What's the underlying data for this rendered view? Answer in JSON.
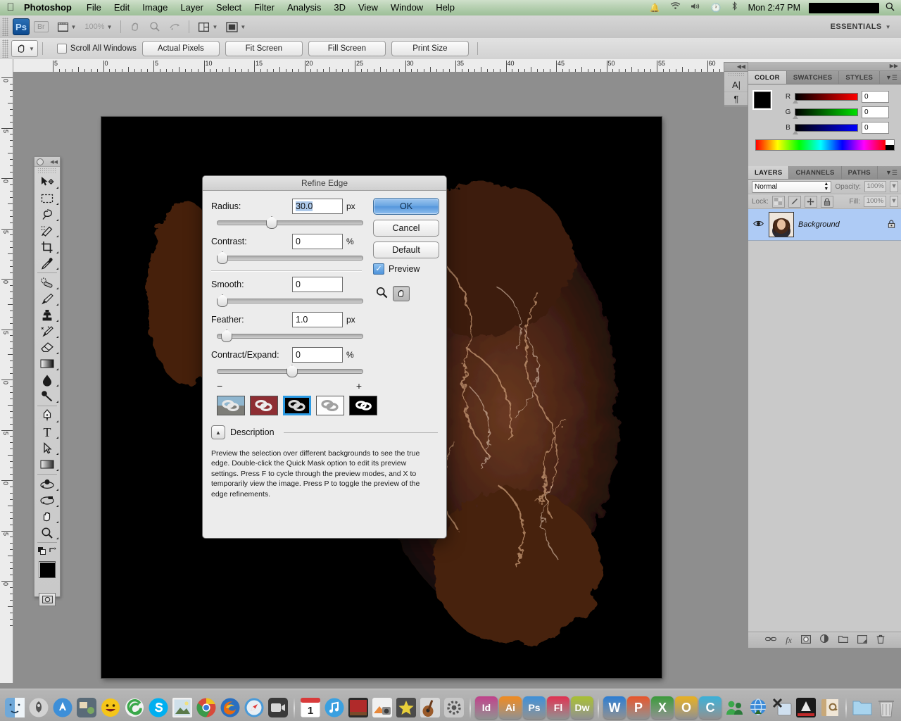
{
  "menubar": {
    "apple_icon": "apple-icon",
    "app_name": "Photoshop",
    "menus": [
      "File",
      "Edit",
      "Image",
      "Layer",
      "Select",
      "Filter",
      "Analysis",
      "3D",
      "View",
      "Window",
      "Help"
    ],
    "status_icons": [
      "notification-bell-icon",
      "wifi-icon",
      "volume-icon",
      "time-machine-icon",
      "bluetooth-icon"
    ],
    "clock": "Mon 2:47 PM",
    "redacted_label": "",
    "search_icon": "spotlight-search-icon"
  },
  "appbar": {
    "logo": "Ps",
    "bridge_label": "Br",
    "mini_bridge_icon": "mini-bridge-icon",
    "zoom_level": "100%",
    "view_extras_icon": "view-extras-icon",
    "hand_icon": "hand-tool-icon",
    "zoom_icon": "zoom-tool-icon",
    "rotate_icon": "rotate-view-icon",
    "arrange_icon": "arrange-documents-icon",
    "screenmode_icon": "screen-mode-icon",
    "workspace": "ESSENTIALS"
  },
  "optionsbar": {
    "active_tool_icon": "hand-tool-icon",
    "scroll_all_windows_label": "Scroll All Windows",
    "scroll_all_windows_checked": false,
    "buttons": [
      "Actual Pixels",
      "Fit Screen",
      "Fill Screen",
      "Print Size"
    ]
  },
  "ruler": {
    "top_labels": [
      "5",
      "0",
      "5",
      "10",
      "15",
      "20",
      "25",
      "30",
      "35",
      "40",
      "45",
      "50",
      "55",
      "60"
    ],
    "left_labels": [
      "0",
      "5",
      "0",
      "5",
      "0",
      "5",
      "0",
      "5",
      "0",
      "5",
      "0"
    ]
  },
  "tools": [
    {
      "name": "move-tool",
      "glyph": "move"
    },
    {
      "name": "rectangular-marquee-tool",
      "glyph": "marquee"
    },
    {
      "name": "lasso-tool",
      "glyph": "lasso"
    },
    {
      "name": "quick-selection-tool",
      "glyph": "quickselect"
    },
    {
      "name": "crop-tool",
      "glyph": "crop"
    },
    {
      "name": "eyedropper-tool",
      "glyph": "eyedropper"
    },
    {
      "name": "spot-healing-brush-tool",
      "glyph": "healing"
    },
    {
      "name": "brush-tool",
      "glyph": "brush"
    },
    {
      "name": "clone-stamp-tool",
      "glyph": "stamp"
    },
    {
      "name": "history-brush-tool",
      "glyph": "historybrush"
    },
    {
      "name": "eraser-tool",
      "glyph": "eraser"
    },
    {
      "name": "gradient-tool",
      "glyph": "gradient"
    },
    {
      "name": "blur-tool",
      "glyph": "blur"
    },
    {
      "name": "dodge-tool",
      "glyph": "dodge"
    },
    {
      "name": "pen-tool",
      "glyph": "pen"
    },
    {
      "name": "type-tool",
      "glyph": "T"
    },
    {
      "name": "path-selection-tool",
      "glyph": "pathselect"
    },
    {
      "name": "rectangle-shape-tool",
      "glyph": "shape"
    },
    {
      "name": "3d-object-rotate-tool",
      "glyph": "rotate3d"
    },
    {
      "name": "3d-camera-rotate-tool",
      "glyph": "camera3d"
    },
    {
      "name": "hand-tool",
      "glyph": "hand"
    },
    {
      "name": "zoom-tool",
      "glyph": "zoom"
    }
  ],
  "color_panel": {
    "tabs": [
      "COLOR",
      "SWATCHES",
      "STYLES"
    ],
    "active_tab": "COLOR",
    "menu_icon": "panel-menu-icon",
    "channels": [
      {
        "label": "R",
        "value": "0"
      },
      {
        "label": "G",
        "value": "0"
      },
      {
        "label": "B",
        "value": "0"
      }
    ],
    "foreground": "#000000",
    "background": "#ffffff"
  },
  "layers_panel": {
    "tabs": [
      "LAYERS",
      "CHANNELS",
      "PATHS"
    ],
    "active_tab": "LAYERS",
    "menu_icon": "panel-menu-icon",
    "blend_mode": "Normal",
    "opacity_label": "Opacity:",
    "opacity_value": "100%",
    "lock_label": "Lock:",
    "lock_icons": [
      "lock-transparency-icon",
      "lock-image-icon",
      "lock-position-icon",
      "lock-all-icon"
    ],
    "fill_label": "Fill:",
    "fill_value": "100%",
    "layers": [
      {
        "name": "Background",
        "visible": true,
        "locked": true,
        "selected": true
      }
    ],
    "footer_icons": [
      "link-layers-icon",
      "layer-style-fx-icon",
      "add-layer-mask-icon",
      "new-adjustment-layer-icon",
      "new-group-icon",
      "new-layer-icon",
      "delete-layer-icon"
    ]
  },
  "side_panel": {
    "icons": [
      "character-panel-icon",
      "paragraph-panel-icon"
    ],
    "collapse_icon": "expand-panels-icon"
  },
  "dialog": {
    "title": "Refine Edge",
    "fields": [
      {
        "label": "Radius:",
        "value": "30.0",
        "unit": "px",
        "slider_pct": 34,
        "selected": true
      },
      {
        "label": "Contrast:",
        "value": "0",
        "unit": "%",
        "slider_pct": 0,
        "selected": false
      },
      {
        "label": "Smooth:",
        "value": "0",
        "unit": "",
        "slider_pct": 0,
        "selected": false
      },
      {
        "label": "Feather:",
        "value": "1.0",
        "unit": "px",
        "slider_pct": 3,
        "selected": false
      },
      {
        "label": "Contract/Expand:",
        "value": "0",
        "unit": "%",
        "slider_pct": 50,
        "selected": false
      }
    ],
    "minus_label": "−",
    "plus_label": "+",
    "buttons": {
      "ok": "OK",
      "cancel": "Cancel",
      "default": "Default"
    },
    "preview_label": "Preview",
    "preview_checked": true,
    "zoom_icon": "zoom-tool-icon",
    "hand_icon": "hand-tool-icon",
    "preview_modes": [
      {
        "name": "standard-preview-mode",
        "selected": false
      },
      {
        "name": "quick-mask-preview-mode",
        "selected": false
      },
      {
        "name": "on-black-preview-mode",
        "selected": true
      },
      {
        "name": "on-white-preview-mode",
        "selected": false
      },
      {
        "name": "mask-preview-mode",
        "selected": false
      }
    ],
    "description_label": "Description",
    "description_toggle_icon": "collapse-triangle-icon",
    "description_text": "Preview the selection over different backgrounds to see the true edge. Double-click the Quick Mask option to edit its preview settings. Press F to cycle through the preview modes, and X to temporarily view the image. Press P to toggle the preview of the edge refinements."
  },
  "dock": {
    "items": [
      {
        "name": "finder",
        "label": "",
        "color": "#5a9bd4",
        "glyph": "finder"
      },
      {
        "name": "launchpad",
        "label": "",
        "color": "#9a9a9a",
        "glyph": "rocket"
      },
      {
        "name": "app-store",
        "label": "",
        "color": "#3d8fd8",
        "glyph": "A"
      },
      {
        "name": "system-preferences",
        "label": "",
        "color": "#6b6b6b",
        "glyph": "gear"
      },
      {
        "name": "yahoo-messenger",
        "label": "",
        "color": "#f5c518",
        "glyph": "smiley"
      },
      {
        "name": "messenger",
        "label": "",
        "color": "#4caf50",
        "glyph": "swirl"
      },
      {
        "name": "skype",
        "label": "",
        "color": "#00aff0",
        "glyph": "S"
      },
      {
        "name": "preview",
        "label": "",
        "color": "#dcdcdc",
        "glyph": "photo"
      },
      {
        "name": "google-chrome",
        "label": "",
        "color": "#4285f4",
        "glyph": "chrome"
      },
      {
        "name": "firefox",
        "label": "",
        "color": "#e66000",
        "glyph": "firefox"
      },
      {
        "name": "safari",
        "label": "",
        "color": "#2e8bd8",
        "glyph": "compass"
      },
      {
        "name": "facetime",
        "label": "",
        "color": "#3a3a3a",
        "glyph": "camera"
      },
      {
        "name": "ical",
        "label": "1",
        "color": "#ffffff",
        "glyph": "calendar"
      },
      {
        "name": "itunes",
        "label": "",
        "color": "#3aa0e0",
        "glyph": "note"
      },
      {
        "name": "keynote",
        "label": "",
        "color": "#b02a2a",
        "glyph": "stage"
      },
      {
        "name": "iphoto",
        "label": "",
        "color": "#e8883a",
        "glyph": "photo2"
      },
      {
        "name": "imovie",
        "label": "",
        "color": "#d8c23a",
        "glyph": "star"
      },
      {
        "name": "garageband",
        "label": "",
        "color": "#9a6a3a",
        "glyph": "guitar"
      },
      {
        "name": "system-settings",
        "label": "",
        "color": "#8a8a8a",
        "glyph": "gear2"
      },
      {
        "name": "indesign",
        "label": "Id",
        "color": "#c0408a",
        "glyph": "text"
      },
      {
        "name": "illustrator",
        "label": "Ai",
        "color": "#f08a1e",
        "glyph": "text"
      },
      {
        "name": "photoshop",
        "label": "Ps",
        "color": "#3d8fd8",
        "glyph": "text"
      },
      {
        "name": "flash",
        "label": "Fl",
        "color": "#e03050",
        "glyph": "text"
      },
      {
        "name": "dreamweaver",
        "label": "Dw",
        "color": "#a8c032",
        "glyph": "text"
      },
      {
        "name": "microsoft-word",
        "label": "W",
        "color": "#2b7cd3",
        "glyph": "letter"
      },
      {
        "name": "microsoft-powerpoint",
        "label": "P",
        "color": "#e8542a",
        "glyph": "letter"
      },
      {
        "name": "microsoft-excel",
        "label": "X",
        "color": "#3a9a3a",
        "glyph": "letter"
      },
      {
        "name": "microsoft-outlook",
        "label": "O",
        "color": "#e8b020",
        "glyph": "letter"
      },
      {
        "name": "microsoft-entourage",
        "label": "C",
        "color": "#3ab0d8",
        "glyph": "letter"
      },
      {
        "name": "msn-messenger",
        "label": "",
        "color": "#3aa84a",
        "glyph": "people"
      },
      {
        "name": "download-manager",
        "label": "",
        "color": "#3a8ad8",
        "glyph": "globe"
      },
      {
        "name": "x11",
        "label": "",
        "color": "#d0d0d0",
        "glyph": "x11"
      },
      {
        "name": "adobe-acrobat",
        "label": "",
        "color": "#1a1a1a",
        "glyph": "acrobat"
      },
      {
        "name": "address-book",
        "label": "",
        "color": "#c8a878",
        "glyph": "book"
      },
      {
        "name": "downloads-folder",
        "label": "",
        "color": "#8fc6e8",
        "glyph": "folder"
      },
      {
        "name": "trash",
        "label": "",
        "color": "#c8c8c8",
        "glyph": "trash"
      }
    ]
  }
}
